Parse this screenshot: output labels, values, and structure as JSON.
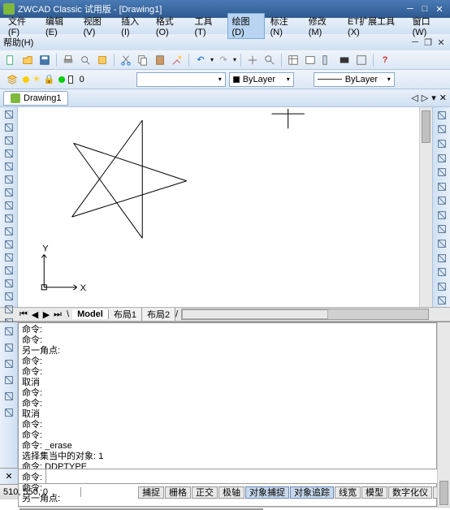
{
  "titlebar": {
    "app": "ZWCAD Classic 试用版",
    "doc": "[Drawing1]"
  },
  "menu": {
    "items": [
      "文件(F)",
      "编辑(E)",
      "视图(V)",
      "插入(I)",
      "格式(O)",
      "工具(T)",
      "绘图(D)",
      "标注(N)",
      "修改(M)",
      "ET扩展工具(X)",
      "窗口(W)"
    ],
    "row2": "帮助(H)",
    "selected": 6
  },
  "layerbar": {
    "layer_name": "0",
    "bylayer1": "ByLayer",
    "bylayer2": "ByLayer"
  },
  "doc_tab": {
    "name": "Drawing1"
  },
  "model_tabs": {
    "model": "Model",
    "layout1": "布局1",
    "layout2": "布局2"
  },
  "cmd_history": "命令:\n命令:\n另一角点:\n命令:\n命令:\n取消\n命令:\n命令:\n取消\n命令:\n命令:\n命令: _erase\n选择集当中的对象: 1\n命令: DDPTYPE\n命令: DDPTYPE\n命令:\n另一角点:",
  "cmd_prompt": "命令:",
  "status": {
    "coords": "510, 550, 0",
    "buttons": [
      "捕捉",
      "栅格",
      "正交",
      "极轴",
      "对象捕捉",
      "对象追踪",
      "线宽",
      "模型",
      "数字化仪",
      "动"
    ],
    "active": [
      4,
      5
    ]
  },
  "left_tools": [
    "line",
    "cline",
    "polyline",
    "polygon",
    "rect",
    "arc",
    "circle",
    "revcloud",
    "spline",
    "ellipse",
    "earc",
    "block",
    "point",
    "hatch",
    "grad",
    "region",
    "table",
    "mtext"
  ],
  "right_tools": [
    "dist",
    "area",
    "region2",
    "list",
    "id",
    "scale",
    "time",
    "status2",
    "param",
    "var",
    "purge",
    "audit",
    "recover",
    "drawstat"
  ],
  "cmd_tools": [
    "qsel",
    "group",
    "layers",
    "dim",
    "props",
    "tpalette"
  ],
  "colors": {
    "accent": "#2d5a8f"
  }
}
